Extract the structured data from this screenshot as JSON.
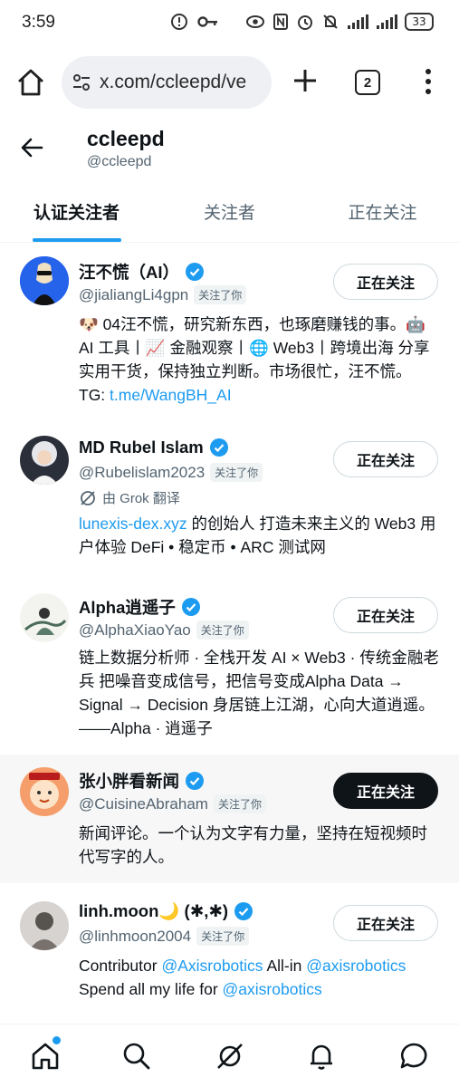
{
  "status_bar": {
    "time": "3:59",
    "battery": "33",
    "icons": [
      "alert-circle-icon",
      "key-icon",
      "eye-icon",
      "nfc-icon",
      "alarm-icon",
      "mute-icon",
      "signal-icon",
      "signal-icon",
      "battery-icon"
    ]
  },
  "browser": {
    "url": "x.com/ccleepd/ve",
    "tab_count": "2"
  },
  "profile": {
    "name": "ccleepd",
    "handle": "@ccleepd"
  },
  "tabs": [
    {
      "label": "认证关注者",
      "active": true
    },
    {
      "label": "关注者",
      "active": false
    },
    {
      "label": "正在关注",
      "active": false
    }
  ],
  "users": [
    {
      "name": "汪不慌（AI）",
      "handle": "@jialiangLi4gpn",
      "follows_you": "关注了你",
      "button": "正在关注",
      "bio_text": "🐶 04汪不慌，研究新东西，也琢磨赚钱的事。🤖 AI 工具丨📈 金融观察丨🌐 Web3丨跨境出海 分享实用干货，保持独立判断。市场很忙，汪不慌。 TG: ",
      "bio_link": "t.me/WangBH_AI"
    },
    {
      "name": "MD Rubel Islam",
      "handle": "@Rubelislam2023",
      "follows_you": "关注了你",
      "button": "正在关注",
      "grok": "由 Grok 翻译",
      "bio_link": "lunexis-dex.xyz",
      "bio_text": " 的创始人 打造未来主义的 Web3 用户体验 DeFi • 稳定币 • ARC 测试网"
    },
    {
      "name": "Alpha逍遥子",
      "handle": "@AlphaXiaoYao",
      "follows_you": "关注了你",
      "button": "正在关注",
      "bio_text": "链上数据分析师 · 全栈开发 AI × Web3 · 传统金融老兵 把噪音变成信号，把信号变成Alpha Data → Signal → Decision 身居链上江湖，心向大道逍遥。 ——Alpha · 逍遥子"
    },
    {
      "name": "张小胖看新闻",
      "handle": "@CuisineAbraham",
      "follows_you": "关注了你",
      "button": "正在关注",
      "bio_text": "新闻评论。一个认为文字有力量，坚持在短视频时代写字的人。"
    },
    {
      "name": "linh.moon🌙 (✱,✱)",
      "handle": "@linhmoon2004",
      "follows_you": "关注了你",
      "button": "正在关注",
      "bio_prefix": "Contributor ",
      "bio_link1": "@Axisrobotics",
      "bio_mid": " All-in ",
      "bio_link2": "@axisrobotics",
      "bio_mid2": " Spend all my life for ",
      "bio_link3": "@axisrobotics"
    }
  ],
  "bottom_nav": [
    "home-icon",
    "search-icon",
    "grok-icon",
    "notifications-icon",
    "messages-icon"
  ],
  "colors": {
    "accent": "#1d9bf0",
    "text": "#0f1419",
    "secondary": "#536471"
  }
}
